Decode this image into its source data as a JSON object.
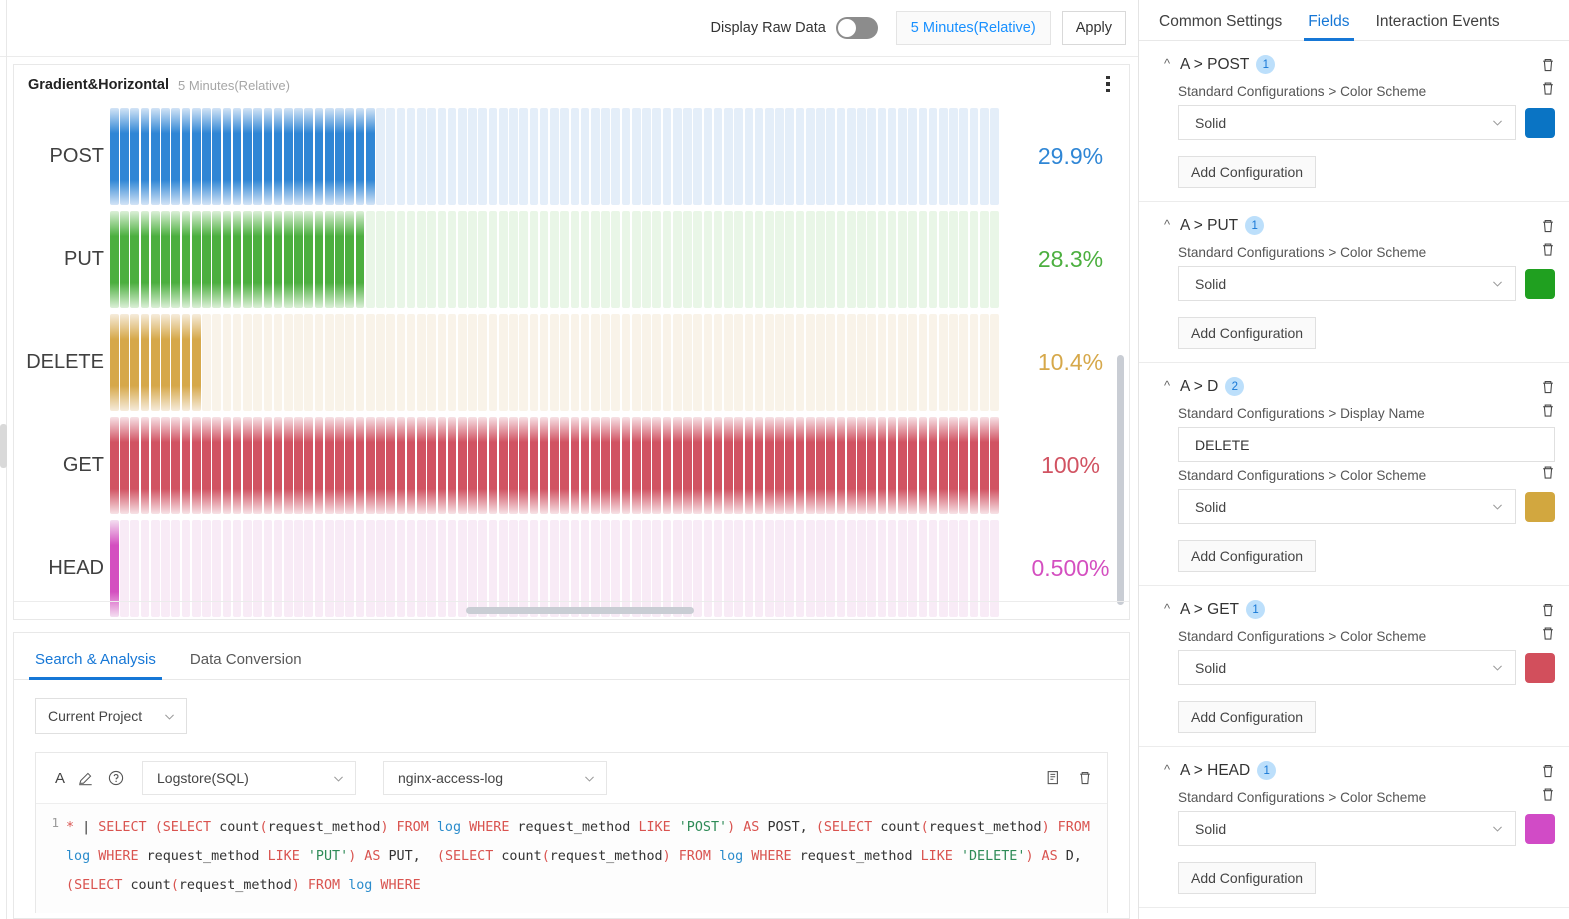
{
  "toolbar": {
    "display_raw_data_label": "Display Raw Data",
    "raw_data_toggle_state": "off",
    "time_range": "5 Minutes(Relative)",
    "apply_label": "Apply"
  },
  "chart_panel": {
    "title": "Gradient&Horizontal",
    "subtitle": "5 Minutes(Relative)",
    "menu_icon": "kebab-menu-icon"
  },
  "chart_data": {
    "type": "bar",
    "orientation": "horizontal",
    "title": "Gradient&Horizontal",
    "subtitle": "5 Minutes(Relative)",
    "categories": [
      "POST",
      "PUT",
      "DELETE",
      "GET",
      "HEAD"
    ],
    "values": [
      29.9,
      28.3,
      10.4,
      100,
      0.5
    ],
    "value_labels": [
      "29.9%",
      "28.3%",
      "10.4%",
      "100%",
      "0.500%"
    ],
    "unit": "%",
    "xlim": [
      0,
      100
    ],
    "segments": 87,
    "grid": false,
    "legend": false,
    "series_colors": [
      "#2f86d5",
      "#4caf3f",
      "#d6a84a",
      "#d15362",
      "#d44fc0"
    ],
    "series_track_colors": [
      "#d3e4f6",
      "#dcf0d8",
      "#f6ecdc",
      "#f7e2e6",
      "#f4dff1"
    ]
  },
  "bottom_panel": {
    "tabs": [
      {
        "label": "Search & Analysis",
        "active": true
      },
      {
        "label": "Data Conversion",
        "active": false
      }
    ],
    "project_select": "Current Project",
    "query": {
      "letter": "A",
      "edit_icon": "pencil-icon",
      "help_icon": "question-circle-icon",
      "type_select": "Logstore(SQL)",
      "logstore_select": "nginx-access-log",
      "copy_icon": "document-copy-icon",
      "delete_icon": "trash-icon",
      "line_number": "1",
      "sql_tokens": [
        {
          "t": "*",
          "c": "k-orange"
        },
        {
          "t": " | ",
          "c": "k-dark"
        },
        {
          "t": "SELECT ",
          "c": "k-orange"
        },
        {
          "t": "(",
          "c": "k-paren"
        },
        {
          "t": "SELECT ",
          "c": "k-orange"
        },
        {
          "t": "count",
          "c": "k-dark"
        },
        {
          "t": "(",
          "c": "k-paren"
        },
        {
          "t": "request_method",
          "c": "k-dark"
        },
        {
          "t": ")",
          "c": "k-paren"
        },
        {
          "t": " FROM ",
          "c": "k-orange"
        },
        {
          "t": "log",
          "c": "k-blue"
        },
        {
          "t": " WHERE ",
          "c": "k-orange"
        },
        {
          "t": "request_method ",
          "c": "k-dark"
        },
        {
          "t": "LIKE ",
          "c": "k-orange"
        },
        {
          "t": "'POST'",
          "c": "k-green"
        },
        {
          "t": ")",
          "c": "k-paren"
        },
        {
          "t": " AS ",
          "c": "k-orange"
        },
        {
          "t": "POST, ",
          "c": "k-dark"
        },
        {
          "t": "(",
          "c": "k-paren"
        },
        {
          "t": "SELECT ",
          "c": "k-orange"
        },
        {
          "t": "count",
          "c": "k-dark"
        },
        {
          "t": "(",
          "c": "k-paren"
        },
        {
          "t": "request_method",
          "c": "k-dark"
        },
        {
          "t": ")",
          "c": "k-paren"
        },
        {
          "t": " FROM ",
          "c": "k-orange"
        },
        {
          "t": "log",
          "c": "k-blue"
        },
        {
          "t": " WHERE ",
          "c": "k-orange"
        },
        {
          "t": "request_method ",
          "c": "k-dark"
        },
        {
          "t": "LIKE ",
          "c": "k-orange"
        },
        {
          "t": "'PUT'",
          "c": "k-green"
        },
        {
          "t": ")",
          "c": "k-paren"
        },
        {
          "t": " AS ",
          "c": "k-orange"
        },
        {
          "t": "PUT,  ",
          "c": "k-dark"
        },
        {
          "t": "(",
          "c": "k-paren"
        },
        {
          "t": "SELECT ",
          "c": "k-orange"
        },
        {
          "t": "count",
          "c": "k-dark"
        },
        {
          "t": "(",
          "c": "k-paren"
        },
        {
          "t": "request_method",
          "c": "k-dark"
        },
        {
          "t": ")",
          "c": "k-paren"
        },
        {
          "t": " FROM ",
          "c": "k-orange"
        },
        {
          "t": "log",
          "c": "k-blue"
        },
        {
          "t": " WHERE ",
          "c": "k-orange"
        },
        {
          "t": "request_method ",
          "c": "k-dark"
        },
        {
          "t": "LIKE ",
          "c": "k-orange"
        },
        {
          "t": "'DELETE'",
          "c": "k-green"
        },
        {
          "t": ")",
          "c": "k-paren"
        },
        {
          "t": " AS ",
          "c": "k-orange"
        },
        {
          "t": "D, ",
          "c": "k-dark"
        },
        {
          "t": "(",
          "c": "k-paren"
        },
        {
          "t": "SELECT ",
          "c": "k-orange"
        },
        {
          "t": "count",
          "c": "k-dark"
        },
        {
          "t": "(",
          "c": "k-paren"
        },
        {
          "t": "request_method",
          "c": "k-dark"
        },
        {
          "t": ")",
          "c": "k-paren"
        },
        {
          "t": " FROM ",
          "c": "k-orange"
        },
        {
          "t": "log",
          "c": "k-blue"
        },
        {
          "t": " WHERE ",
          "c": "k-orange"
        }
      ]
    }
  },
  "right_panel": {
    "tabs": [
      {
        "label": "Common Settings",
        "active": false
      },
      {
        "label": "Fields",
        "active": true
      },
      {
        "label": "Interaction Events",
        "active": false
      }
    ],
    "add_configuration_label": "Add Configuration",
    "groups": [
      {
        "title": "A > POST",
        "count": "1",
        "configs": [
          {
            "label": "Standard Configurations > Color Scheme",
            "kind": "select",
            "value": "Solid",
            "swatch": "#0a74c4"
          }
        ]
      },
      {
        "title": "A > PUT",
        "count": "1",
        "configs": [
          {
            "label": "Standard Configurations > Color Scheme",
            "kind": "select",
            "value": "Solid",
            "swatch": "#20a020"
          }
        ]
      },
      {
        "title": "A > D",
        "count": "2",
        "configs": [
          {
            "label": "Standard Configurations > Display Name",
            "kind": "input",
            "value": "DELETE",
            "swatch": null
          },
          {
            "label": "Standard Configurations > Color Scheme",
            "kind": "select",
            "value": "Solid",
            "swatch": "#d2a73f"
          }
        ]
      },
      {
        "title": "A > GET",
        "count": "1",
        "configs": [
          {
            "label": "Standard Configurations > Color Scheme",
            "kind": "select",
            "value": "Solid",
            "swatch": "#d24f5c"
          }
        ]
      },
      {
        "title": "A > HEAD",
        "count": "1",
        "configs": [
          {
            "label": "Standard Configurations > Color Scheme",
            "kind": "select",
            "value": "Solid",
            "swatch": "#d14bc6"
          }
        ]
      }
    ]
  }
}
